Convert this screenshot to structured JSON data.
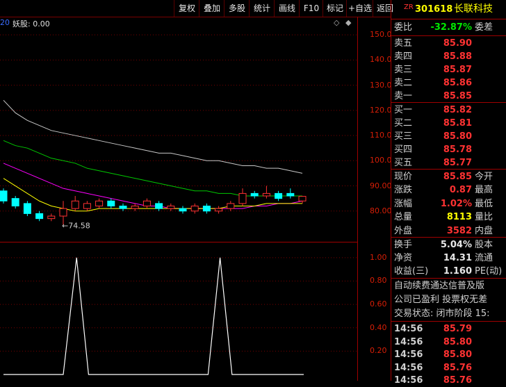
{
  "toolbar": {
    "buttons": [
      "复权",
      "叠加",
      "多股",
      "统计",
      "画线",
      "F10",
      "标记",
      "+自选",
      "返回"
    ]
  },
  "indicator": {
    "prefix": "20",
    "label": "妖股: 0.00"
  },
  "price_axis": [
    "150.0",
    "140.0",
    "130.0",
    "120.0",
    "110.0",
    "100.0",
    "90.00",
    "80.00"
  ],
  "low_label": "←74.58",
  "sub_axis": [
    "1.00",
    "0.80",
    "0.60",
    "0.40",
    "0.20"
  ],
  "stock": {
    "badge": "ZR",
    "code": "301618",
    "name": "长联科技"
  },
  "webi": {
    "k": "委比",
    "v": "-32.87%",
    "k2": "委差"
  },
  "asks": [
    {
      "k": "卖五",
      "v": "85.90"
    },
    {
      "k": "卖四",
      "v": "85.88"
    },
    {
      "k": "卖三",
      "v": "85.87"
    },
    {
      "k": "卖二",
      "v": "85.86"
    },
    {
      "k": "卖一",
      "v": "85.85"
    }
  ],
  "bids": [
    {
      "k": "买一",
      "v": "85.82"
    },
    {
      "k": "买二",
      "v": "85.81"
    },
    {
      "k": "买三",
      "v": "85.80"
    },
    {
      "k": "买四",
      "v": "85.78"
    },
    {
      "k": "买五",
      "v": "85.77"
    }
  ],
  "quote": [
    {
      "k": "现价",
      "v": "85.85",
      "k2": "今开",
      "c": "red"
    },
    {
      "k": "涨跌",
      "v": "0.87",
      "k2": "最高",
      "c": "red"
    },
    {
      "k": "涨幅",
      "v": "1.02%",
      "k2": "最低",
      "c": "red"
    },
    {
      "k": "总量",
      "v": "8113",
      "k2": "量比",
      "c": "yellow"
    },
    {
      "k": "外盘",
      "v": "3582",
      "k2": "内盘",
      "c": "red"
    }
  ],
  "stats": [
    {
      "k": "换手",
      "v": "5.04%",
      "k2": "股本"
    },
    {
      "k": "净资",
      "v": "14.31",
      "k2": "流通"
    },
    {
      "k": "收益(三)",
      "v": "1.160",
      "k2": "PE(动)"
    }
  ],
  "news": "自动续费通达信普及版",
  "info1": "公司已盈利 投票权无差",
  "info2": "交易状态: 闭市阶段 15:",
  "ticks": [
    {
      "t": "14:56",
      "p": "85.79"
    },
    {
      "t": "14:56",
      "p": "85.80"
    },
    {
      "t": "14:56",
      "p": "85.80"
    },
    {
      "t": "14:56",
      "p": "85.76"
    },
    {
      "t": "14:56",
      "p": "85.76"
    }
  ],
  "colors": {
    "up": "#ff3232",
    "down": "#00ffff",
    "ma_white": "#c8c8c8",
    "ma_green": "#00c800",
    "ma_magenta": "#ff00ff",
    "ma_yellow": "#ffff00"
  },
  "chart_data": {
    "type": "candlestick",
    "ylim": [
      70,
      155
    ],
    "candles": [
      {
        "o": 88,
        "c": 84,
        "h": 89,
        "l": 83
      },
      {
        "o": 85,
        "c": 82,
        "h": 86,
        "l": 81
      },
      {
        "o": 83,
        "c": 79,
        "h": 84,
        "l": 78
      },
      {
        "o": 79,
        "c": 77,
        "h": 80,
        "l": 76
      },
      {
        "o": 77,
        "c": 78,
        "h": 79,
        "l": 76
      },
      {
        "o": 78,
        "c": 81,
        "h": 84,
        "l": 74.58
      },
      {
        "o": 81,
        "c": 84,
        "h": 86,
        "l": 80
      },
      {
        "o": 81,
        "c": 83,
        "h": 84,
        "l": 80
      },
      {
        "o": 82,
        "c": 84,
        "h": 85,
        "l": 81
      },
      {
        "o": 84,
        "c": 82,
        "h": 85,
        "l": 81
      },
      {
        "o": 82,
        "c": 81,
        "h": 83,
        "l": 80
      },
      {
        "o": 81,
        "c": 82,
        "h": 83,
        "l": 80
      },
      {
        "o": 82,
        "c": 84,
        "h": 85,
        "l": 81
      },
      {
        "o": 83,
        "c": 81,
        "h": 84,
        "l": 80
      },
      {
        "o": 81,
        "c": 82,
        "h": 83,
        "l": 80
      },
      {
        "o": 81,
        "c": 80,
        "h": 82,
        "l": 79
      },
      {
        "o": 80,
        "c": 82,
        "h": 83,
        "l": 79
      },
      {
        "o": 82,
        "c": 80,
        "h": 83,
        "l": 79
      },
      {
        "o": 80,
        "c": 81,
        "h": 82,
        "l": 79
      },
      {
        "o": 81,
        "c": 83,
        "h": 84,
        "l": 80
      },
      {
        "o": 83,
        "c": 87,
        "h": 89,
        "l": 82
      },
      {
        "o": 87,
        "c": 86,
        "h": 88,
        "l": 85
      },
      {
        "o": 86,
        "c": 87,
        "h": 90,
        "l": 85
      },
      {
        "o": 87,
        "c": 85,
        "h": 88,
        "l": 84
      },
      {
        "o": 87,
        "c": 86,
        "h": 89,
        "l": 85
      },
      {
        "o": 84,
        "c": 85.85,
        "h": 86,
        "l": 83
      }
    ],
    "ma": [
      {
        "color": "ma_white",
        "v": [
          124,
          119,
          116,
          114,
          112,
          111,
          110,
          109,
          108,
          107,
          106,
          105,
          104,
          103,
          103,
          102,
          101,
          100,
          100,
          99,
          98,
          98,
          97,
          97,
          96,
          95
        ]
      },
      {
        "color": "ma_green",
        "v": [
          108,
          106,
          105,
          103,
          101,
          100,
          99,
          97,
          96,
          95,
          94,
          93,
          92,
          91,
          90,
          89,
          88,
          88,
          87,
          87,
          86,
          86,
          86,
          86,
          86,
          86
        ]
      },
      {
        "color": "ma_magenta",
        "v": [
          99,
          97,
          95,
          93,
          91,
          89,
          88,
          87,
          86,
          85,
          84,
          83,
          82,
          82,
          81,
          81,
          81,
          81,
          81,
          81,
          81,
          82,
          82,
          83,
          83,
          84
        ]
      },
      {
        "color": "ma_yellow",
        "v": [
          93,
          90,
          87,
          84,
          82,
          81,
          80,
          80,
          81,
          81,
          81,
          81,
          81,
          81,
          81,
          81,
          81,
          81,
          81,
          82,
          82,
          82,
          83,
          83,
          83,
          83
        ]
      }
    ],
    "sub_values": [
      0,
      0,
      0,
      0,
      0,
      0,
      1,
      0,
      0,
      0,
      0,
      0,
      0,
      0,
      0,
      0,
      0,
      0,
      1,
      0,
      0,
      0,
      0,
      0,
      0,
      0
    ],
    "sub_ylim": [
      0,
      1.1
    ]
  }
}
